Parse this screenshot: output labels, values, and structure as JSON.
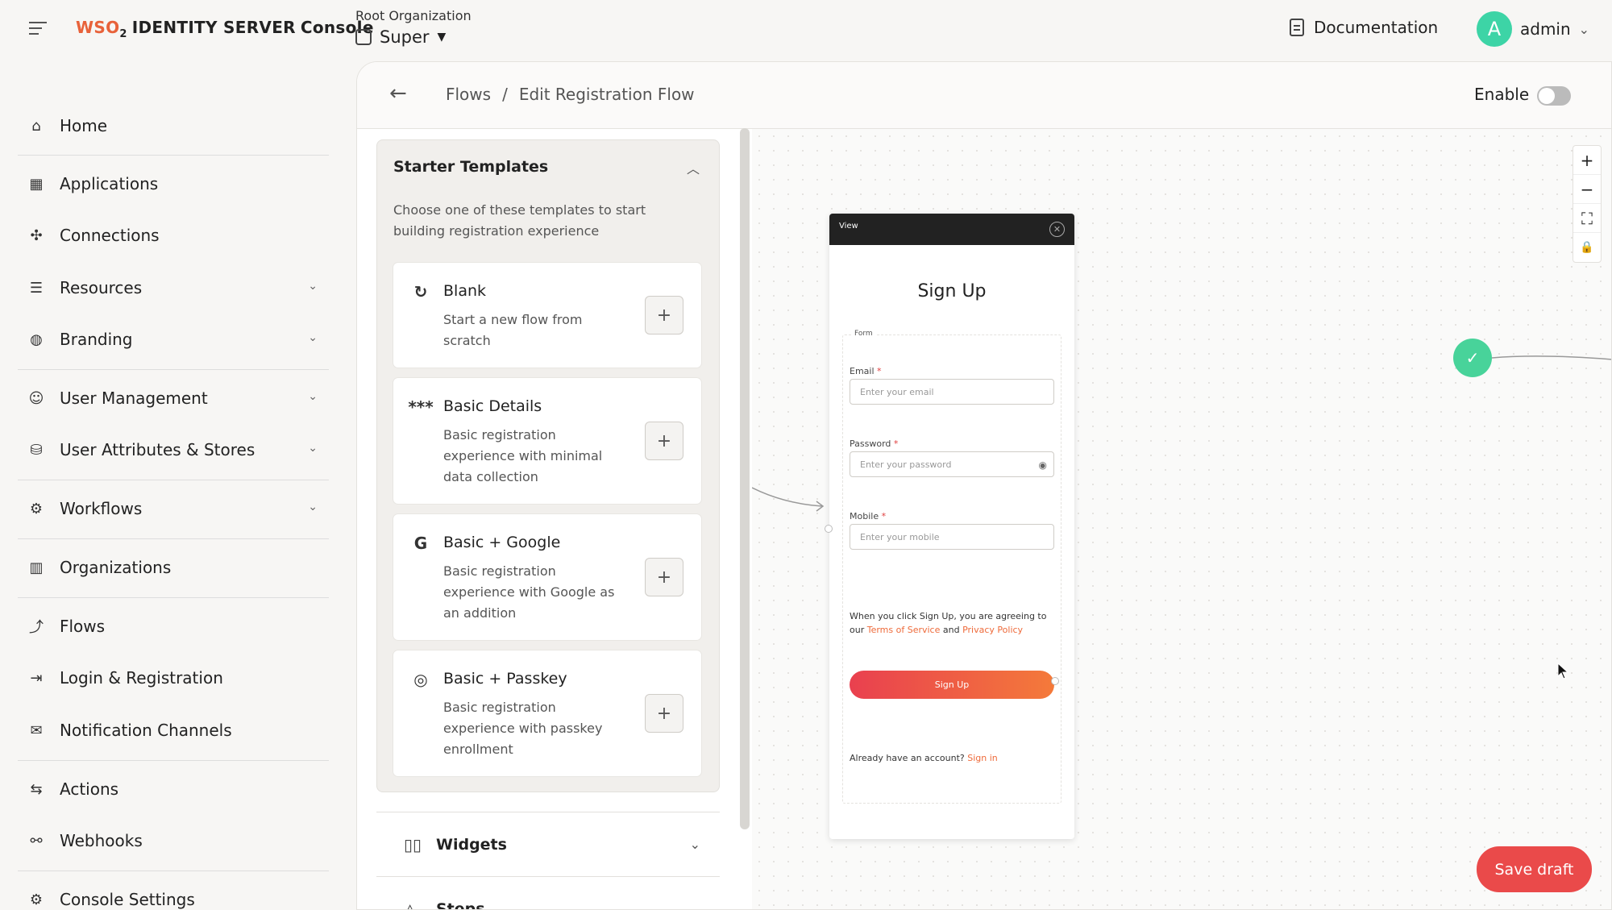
{
  "header": {
    "logo_wso": "WSO",
    "logo_sub": "2",
    "logo_product": "IDENTITY SERVER",
    "logo_console": "Console",
    "org_label": "Root Organization",
    "org_name": "Super",
    "documentation": "Documentation",
    "user_initial": "A",
    "user_name": "admin"
  },
  "sidebar": {
    "items": [
      {
        "label": "Home",
        "icon": "home-icon"
      },
      {
        "label": "Applications",
        "icon": "grid-icon"
      },
      {
        "label": "Connections",
        "icon": "connections-icon"
      },
      {
        "label": "Resources",
        "icon": "resources-icon"
      },
      {
        "label": "Branding",
        "icon": "palette-icon"
      },
      {
        "label": "User Management",
        "icon": "user-icon"
      },
      {
        "label": "User Attributes & Stores",
        "icon": "database-icon"
      },
      {
        "label": "Workflows",
        "icon": "workflow-icon"
      },
      {
        "label": "Organizations",
        "icon": "building-icon"
      },
      {
        "label": "Flows",
        "icon": "flow-icon"
      },
      {
        "label": "Login & Registration",
        "icon": "login-icon"
      },
      {
        "label": "Notification Channels",
        "icon": "notification-icon"
      },
      {
        "label": "Actions",
        "icon": "actions-icon"
      },
      {
        "label": "Webhooks",
        "icon": "webhook-icon"
      },
      {
        "label": "Console Settings",
        "icon": "gear-icon"
      }
    ]
  },
  "page": {
    "breadcrumb_root": "Flows",
    "breadcrumb_sep": "/",
    "breadcrumb_current": "Edit Registration Flow",
    "enable_label": "Enable"
  },
  "templates": {
    "title": "Starter Templates",
    "description": "Choose one of these templates to start building registration experience",
    "cards": [
      {
        "name": "Blank",
        "description": "Start a new flow from scratch",
        "icon": "refresh-icon"
      },
      {
        "name": "Basic Details",
        "description": "Basic registration experience with minimal data collection",
        "icon": "asterisks-icon"
      },
      {
        "name": "Basic + Google",
        "description": "Basic registration experience with Google as an addition",
        "icon": "google-icon"
      },
      {
        "name": "Basic + Passkey",
        "description": "Basic registration experience with passkey enrollment",
        "icon": "fingerprint-icon"
      }
    ],
    "add_symbol": "+"
  },
  "accordions": {
    "widgets": "Widgets",
    "steps": "Steps"
  },
  "view_node": {
    "label": "View",
    "title": "Sign Up",
    "form_tag": "Form",
    "email_label": "Email",
    "email_placeholder": "Enter your email",
    "password_label": "Password",
    "password_placeholder": "Enter your password",
    "mobile_label": "Mobile",
    "mobile_placeholder": "Enter your mobile",
    "required_mark": "*",
    "consent_prefix": "When you click Sign Up, you are agreeing to our ",
    "terms": "Terms of Service",
    "consent_and": " and ",
    "privacy": "Privacy Policy",
    "signup_button": "Sign Up",
    "already_prefix": "Already have an account? ",
    "signin_link": "Sign in"
  },
  "canvas": {
    "zoom_in": "+",
    "zoom_out": "−",
    "fit": "⛶",
    "lock": "🔒"
  },
  "actions": {
    "save_draft": "Save draft"
  },
  "colors": {
    "accent": "#ee6a3a",
    "save_button": "#ea4a4a",
    "end_node": "#48d39a",
    "avatar": "#3dd4a6"
  }
}
